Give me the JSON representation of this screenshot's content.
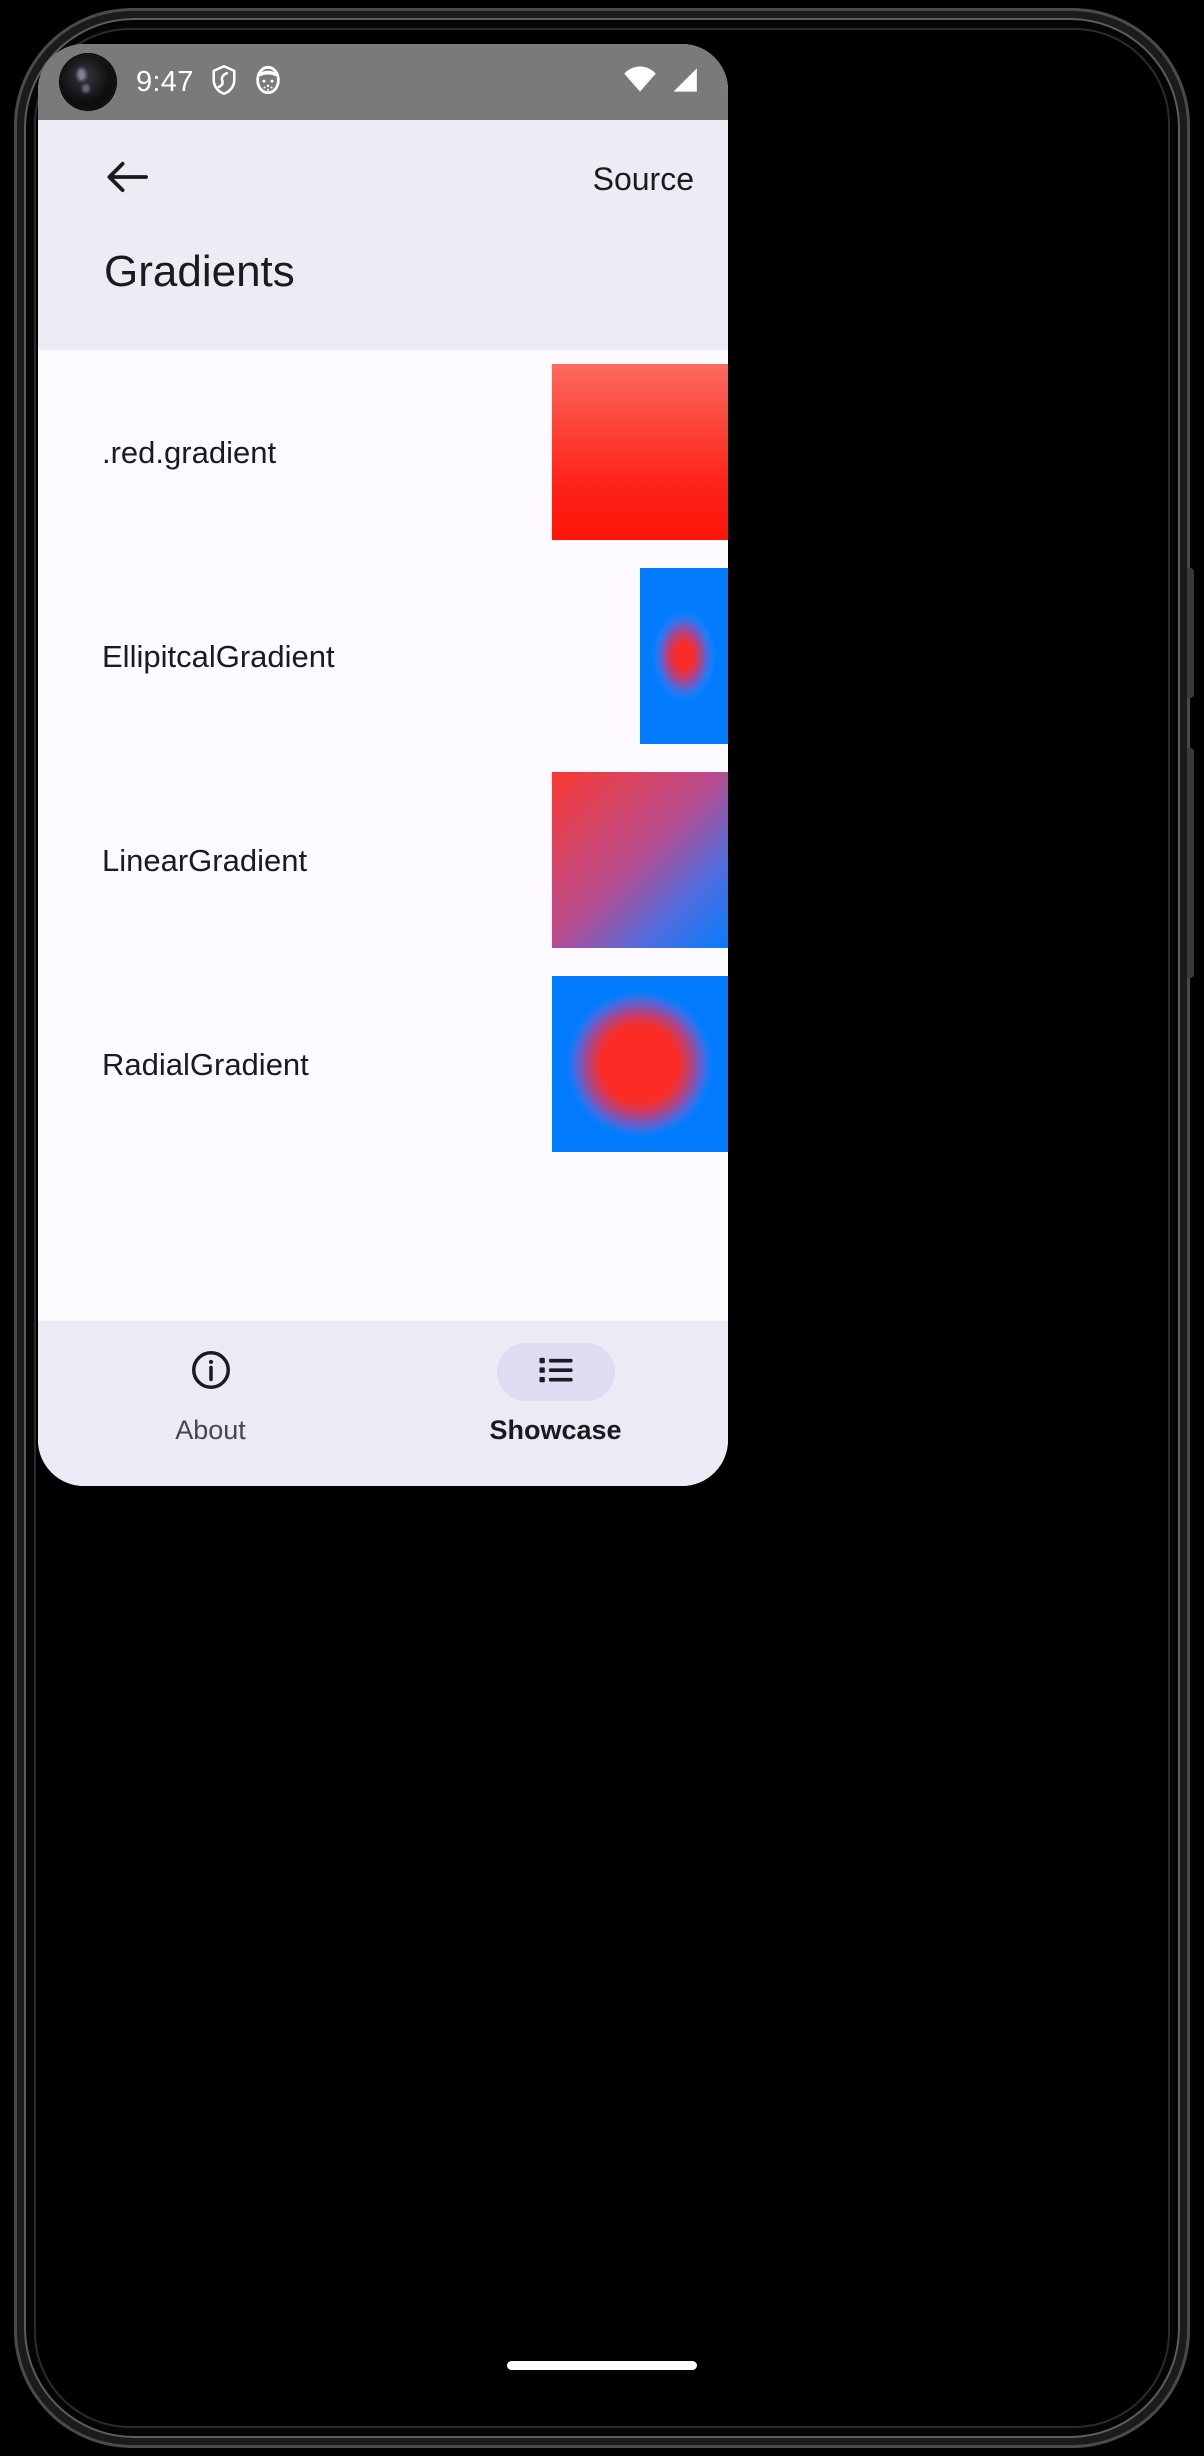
{
  "status_bar": {
    "clock": "9:47",
    "left_icons": [
      "shield-icon",
      "cat-face-icon"
    ],
    "right_icons": [
      "wifi-icon",
      "cellular-signal-icon"
    ],
    "background_color": "#7a7a7a",
    "text_color": "#ffffff"
  },
  "app_bar": {
    "back_icon": "arrow-left-icon",
    "source_label": "Source",
    "title": "Gradients",
    "background_color": "#edecf5"
  },
  "list": {
    "background_color": "#fcfaff",
    "rows": [
      {
        "label": ".red.gradient",
        "swatch_type": "linear-vertical",
        "swatch_shape": "wide",
        "colors": [
          "#fc6b60",
          "#ff1408"
        ]
      },
      {
        "label": "EllipitcalGradient",
        "swatch_type": "elliptical",
        "swatch_shape": "narrow",
        "colors": [
          "#fb2c25",
          "#027cfd"
        ]
      },
      {
        "label": "LinearGradient",
        "swatch_type": "linear-diagonal",
        "swatch_shape": "wide",
        "colors": [
          "#f93a31",
          "#067bfc"
        ]
      },
      {
        "label": "RadialGradient",
        "swatch_type": "radial",
        "swatch_shape": "wide",
        "colors": [
          "#fb2c25",
          "#027cfd"
        ]
      }
    ]
  },
  "bottom_nav": {
    "background_color": "#eceaf5",
    "selected_pill_color": "#dedbf2",
    "items": [
      {
        "label": "About",
        "icon": "info-circle-icon",
        "selected": false
      },
      {
        "label": "Showcase",
        "icon": "list-bullet-icon",
        "selected": true
      }
    ]
  }
}
